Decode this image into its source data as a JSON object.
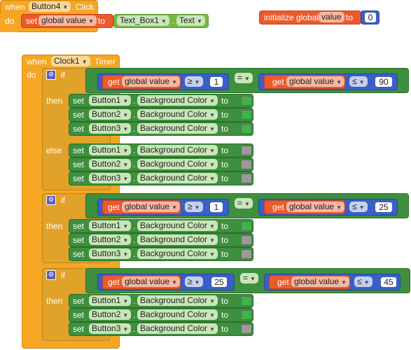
{
  "kw": {
    "when": "when",
    "do": "do",
    "set": "set",
    "to": "to",
    "get": "get",
    "if": "if",
    "then": "then",
    "else": "else",
    "dot": ".",
    "init": "initialize global"
  },
  "event1": {
    "component": "Button4",
    "event": "Click",
    "var": "global value",
    "src_component": "Text_Box1",
    "src_prop": "Text"
  },
  "init": {
    "name": "value",
    "value": "0"
  },
  "event2": {
    "component": "Clock1",
    "event": "Timer"
  },
  "blocks": [
    {
      "var": "global value",
      "op1": "≥",
      "n1": "1",
      "eq": "=",
      "op2": "≤",
      "n2": "90"
    },
    {
      "var": "global value",
      "op1": "≥",
      "n1": "1",
      "eq": "=",
      "op2": "≤",
      "n2": "25"
    },
    {
      "var": "global value",
      "op1": "≥",
      "n1": "25",
      "eq": "=",
      "op2": "≤",
      "n2": "45"
    }
  ],
  "buttons": [
    "Button1",
    "Button2",
    "Button3"
  ],
  "prop": "Background Color",
  "colors": {
    "green": "#3fb24a",
    "gray": "#9a9a9a"
  }
}
